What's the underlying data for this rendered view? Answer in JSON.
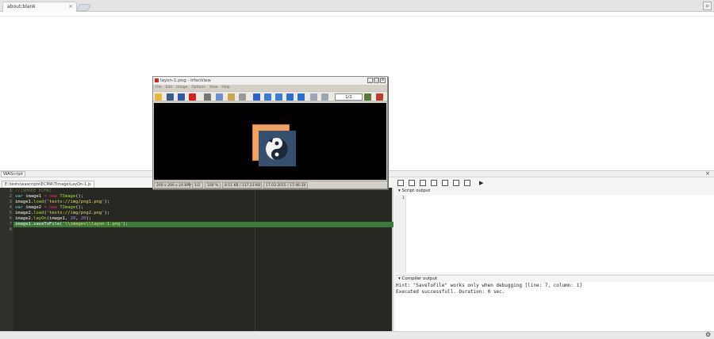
{
  "browser": {
    "tab_title": "about:blank",
    "tab_close": "×"
  },
  "window": {
    "control_label": "▫"
  },
  "wascript": {
    "panel_title": "WAScript",
    "panel_close": "×",
    "file_tab": "E:\\tests\\wascripts\\ECMA\\TImage\\LayOn-1.js",
    "highlighted_line": 7,
    "code": {
      "line_numbers": [
        "1",
        "2",
        "3",
        "4",
        "5",
        "6",
        "7",
        "8"
      ],
      "lines": [
        [
          {
            "t": "//{$MODE ECMA}",
            "c": "cmt"
          }
        ],
        [
          {
            "t": "var",
            "c": "kw"
          },
          {
            "t": " image1 ",
            "c": "plain"
          },
          {
            "t": "=",
            "c": "op"
          },
          {
            "t": " ",
            "c": "plain"
          },
          {
            "t": "new",
            "c": "op"
          },
          {
            "t": " ",
            "c": "plain"
          },
          {
            "t": "TImage",
            "c": "fn"
          },
          {
            "t": "();",
            "c": "plain"
          }
        ],
        [
          {
            "t": "image1.",
            "c": "plain"
          },
          {
            "t": "load",
            "c": "fn"
          },
          {
            "t": "(",
            "c": "plain"
          },
          {
            "t": "'tests://img/png1.png'",
            "c": "str"
          },
          {
            "t": ");",
            "c": "plain"
          }
        ],
        [
          {
            "t": "var",
            "c": "kw"
          },
          {
            "t": " image2 ",
            "c": "plain"
          },
          {
            "t": "=",
            "c": "op"
          },
          {
            "t": " ",
            "c": "plain"
          },
          {
            "t": "new",
            "c": "op"
          },
          {
            "t": " ",
            "c": "plain"
          },
          {
            "t": "TImage",
            "c": "fn"
          },
          {
            "t": "();",
            "c": "plain"
          }
        ],
        [
          {
            "t": "image2.",
            "c": "plain"
          },
          {
            "t": "load",
            "c": "fn"
          },
          {
            "t": "(",
            "c": "plain"
          },
          {
            "t": "'tests://img/png2.png'",
            "c": "str"
          },
          {
            "t": ");",
            "c": "plain"
          }
        ],
        [
          {
            "t": "image2.",
            "c": "plain"
          },
          {
            "t": "layOn",
            "c": "fn"
          },
          {
            "t": "(image1, ",
            "c": "plain"
          },
          {
            "t": "20",
            "c": "num"
          },
          {
            "t": ", ",
            "c": "plain"
          },
          {
            "t": "20",
            "c": "num"
          },
          {
            "t": ");",
            "c": "plain"
          }
        ],
        [
          {
            "t": "image1.saveToFile(",
            "c": "plain"
          },
          {
            "t": "'\\\\images\\\\layon-1.png'",
            "c": "str"
          },
          {
            "t": ");",
            "c": "plain"
          }
        ],
        []
      ]
    },
    "right_toolbar": {
      "run_glyph": "▶"
    },
    "script_output": {
      "header": "Script output",
      "collapse_glyph": "▾",
      "line_number": "1"
    },
    "compiler_output": {
      "header": "Compiler output",
      "collapse_glyph": "▾",
      "lines": [
        "Hint: \"SaveToFile\" works only when debugging [line: 7, column: 1]",
        "Executed successfull. Duration: 0 sec."
      ]
    },
    "status_gear_glyph": "⚙"
  },
  "irfanview": {
    "title": "layon-1.png - IrfanView",
    "window_buttons": [
      "_",
      "□",
      "×"
    ],
    "menu": [
      "File",
      "Edit",
      "Image",
      "Options",
      "View",
      "Help"
    ],
    "page_indicator": "1/2",
    "toolbar_icons": [
      {
        "name": "open-folder-icon",
        "color": "#e8b83a"
      },
      {
        "name": "slideshow-icon",
        "color": "#3a5b8c"
      },
      {
        "name": "save-icon",
        "color": "#2e5aa8"
      },
      {
        "name": "delete-icon",
        "color": "#d42020"
      },
      {
        "name": "cut-icon",
        "color": "#777777"
      },
      {
        "name": "copy-icon",
        "color": "#6a8fc9"
      },
      {
        "name": "paste-icon",
        "color": "#c9a650"
      },
      {
        "name": "undo-icon",
        "color": "#9a9a9a"
      },
      {
        "name": "info-icon",
        "color": "#2a62c9"
      },
      {
        "name": "zoom-in-icon",
        "color": "#3a7bd5"
      },
      {
        "name": "zoom-out-icon",
        "color": "#3a7bd5"
      },
      {
        "name": "previous-icon",
        "color": "#2a6fd0"
      },
      {
        "name": "next-icon",
        "color": "#2a6fd0"
      },
      {
        "name": "first-page-icon",
        "color": "#9aa7b8"
      },
      {
        "name": "last-page-icon",
        "color": "#9aa7b8"
      },
      {
        "name": "settings-icon",
        "color": "#5a7a3a"
      },
      {
        "name": "exit-icon",
        "color": "#c23a2a"
      }
    ],
    "status": [
      "200 x 200 x 24 BPP",
      "1/2",
      "100 %",
      "8.51 KB / 117.23 KB",
      "17.03.2015 / 17:46:30"
    ]
  },
  "colors": {
    "editor_bg": "#272822",
    "highlight_line": "#3d7a3a",
    "image_orange": "#f2a15e",
    "image_blue": "#35506f"
  }
}
